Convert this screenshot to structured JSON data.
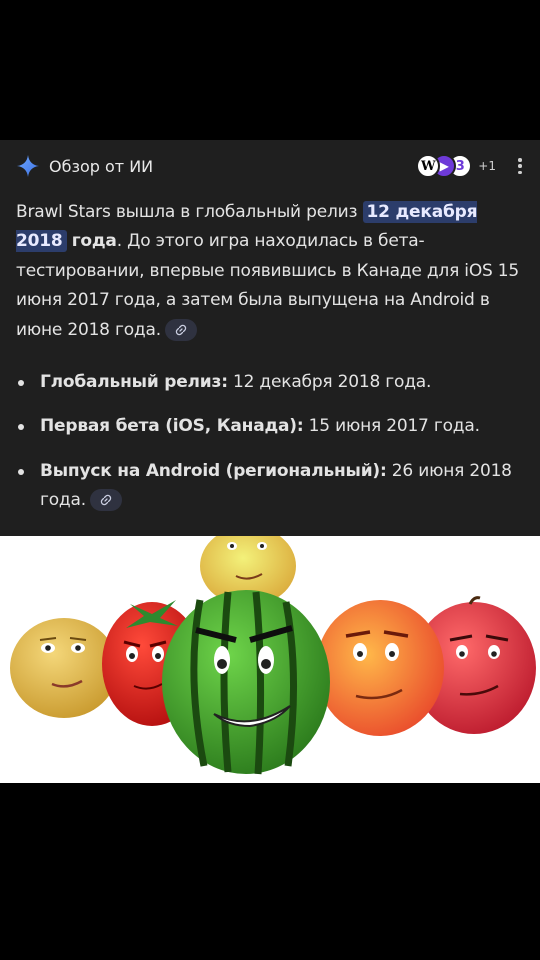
{
  "overview": {
    "title": "Обзор от ИИ",
    "sources_more": "+1",
    "summary": {
      "part1": "Brawl Stars вышла в глобальный релиз ",
      "highlight1": "12 декабря 2018",
      "highlight2": "года",
      "part2": ". До этого игра находилась в бета-тестировании, впервые появившись в Канаде для iOS 15 июня 2017 года, а затем была выпущена на Android в июне 2018 года."
    },
    "bullets": [
      {
        "label": "Глобальный релиз:",
        "value": " 12 декабря 2018 года."
      },
      {
        "label": "Первая бета (iOS, Канада):",
        "value": " 15 июня 2017 года."
      },
      {
        "label": "Выпуск на Android (региональный):",
        "value": " 26 июня 2018 года."
      }
    ]
  },
  "colors": {
    "panel_bg": "#1f1f1f",
    "text": "#e3e3e3",
    "highlight_bg": "#2c3d6b",
    "sparkle": "#4f8df7"
  }
}
